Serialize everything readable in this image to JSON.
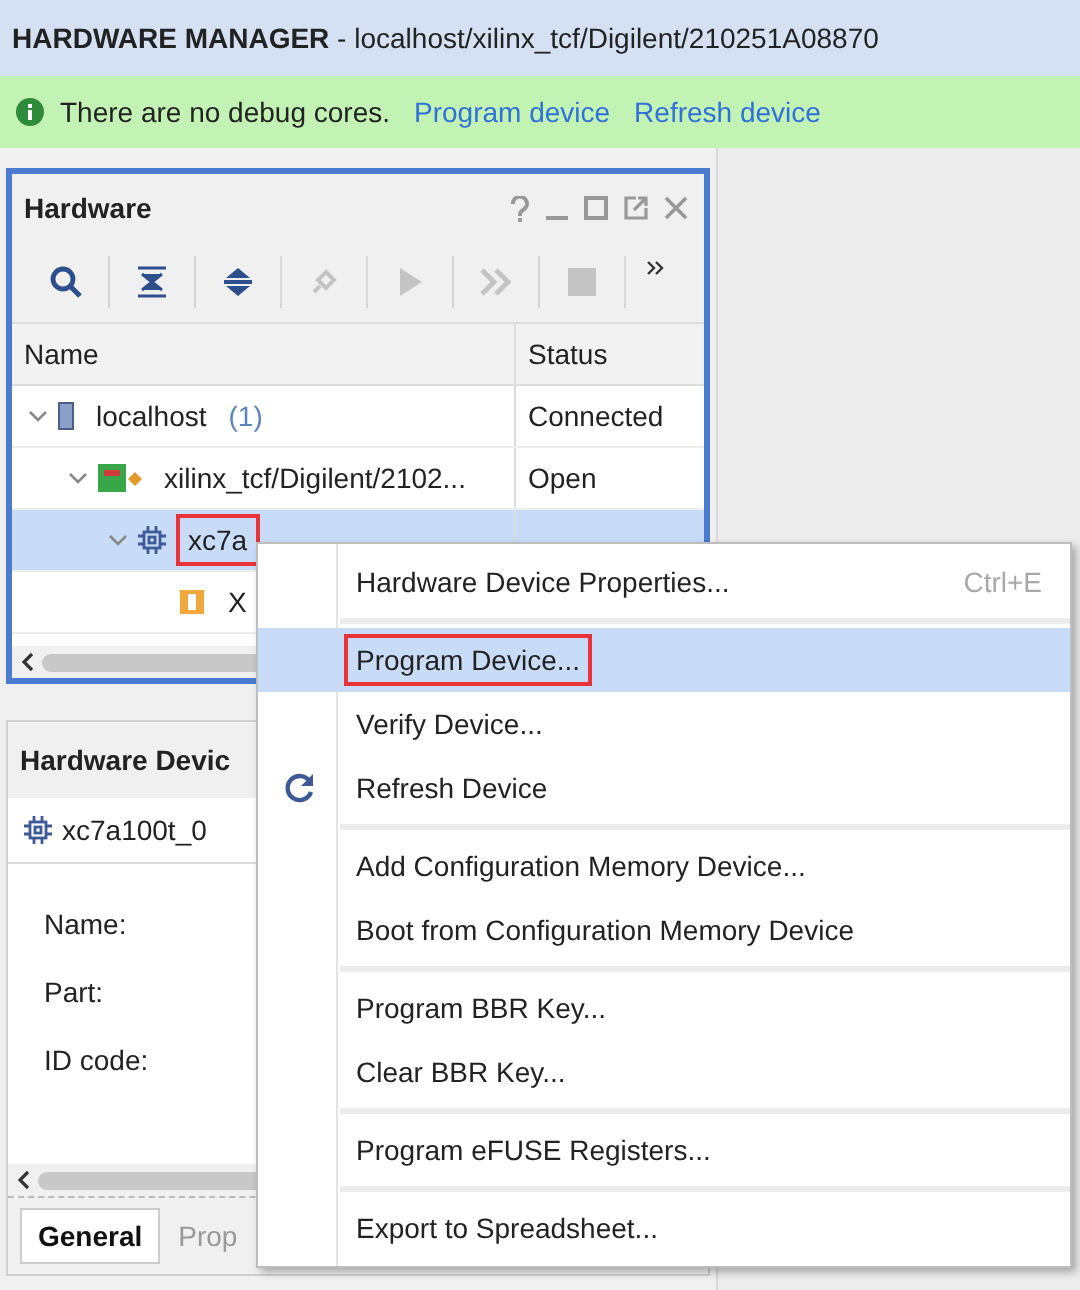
{
  "header": {
    "title": "**HARDWARE MANAGER** - localhost/xilinx_tcf/Digilent/210251A08870"
  },
  "banner": {
    "message": "There are no debug cores.",
    "links": [
      "Program device",
      "Refresh device"
    ]
  },
  "hardware_panel": {
    "title": "Hardware",
    "columns": [
      "Name",
      "Status"
    ],
    "tree": [
      {
        "kind": "server",
        "name": "localhost",
        "count": "(1)",
        "status": "Connected",
        "expanded": true,
        "selected": false,
        "highlighted": false,
        "children": [
          {
            "kind": "cable",
            "name": "xilinx_tcf/Digilent/2102...",
            "status": "Open",
            "expanded": true,
            "selected": false,
            "highlighted": false,
            "children": [
              {
                "kind": "chip",
                "name": "xc7a",
                "expanded": true,
                "selected": true,
                "highlighted": true,
                "children": [
                  {
                    "kind": "core",
                    "name": "X",
                    "selected": false,
                    "highlighted": false
                  }
                ]
              }
            ]
          }
        ]
      }
    ]
  },
  "device_panel": {
    "title": "Hardware Devic",
    "device": "xc7a100t_0",
    "properties": [
      "Name:",
      "Part:",
      "ID code:"
    ],
    "tabs": [
      {
        "label": "General",
        "selected": true
      },
      {
        "label": "Prop",
        "selected": false
      }
    ]
  },
  "context_menu": {
    "groups": [
      [
        {
          "kind": "plain",
          "label": "Hardware Device Properties...",
          "shortcut": "Ctrl+E",
          "selected": false,
          "highlighted": false
        }
      ],
      [
        {
          "kind": "plain",
          "label": "Program Device...",
          "selected": true,
          "highlighted": true
        },
        {
          "kind": "plain",
          "label": "Verify Device...",
          "selected": false,
          "highlighted": false
        },
        {
          "kind": "refresh",
          "label": "Refresh Device",
          "selected": false,
          "highlighted": false
        }
      ],
      [
        {
          "kind": "plain",
          "label": "Add Configuration Memory Device...",
          "selected": false,
          "highlighted": false
        },
        {
          "kind": "plain",
          "label": "Boot from Configuration Memory Device",
          "selected": false,
          "highlighted": false
        }
      ],
      [
        {
          "kind": "plain",
          "label": "Program BBR Key...",
          "selected": false,
          "highlighted": false
        },
        {
          "kind": "plain",
          "label": "Clear BBR Key...",
          "selected": false,
          "highlighted": false
        }
      ],
      [
        {
          "kind": "plain",
          "label": "Program eFUSE Registers...",
          "selected": false,
          "highlighted": false
        }
      ],
      [
        {
          "kind": "plain",
          "label": "Export to Spreadsheet...",
          "selected": false,
          "highlighted": false
        }
      ]
    ]
  }
}
